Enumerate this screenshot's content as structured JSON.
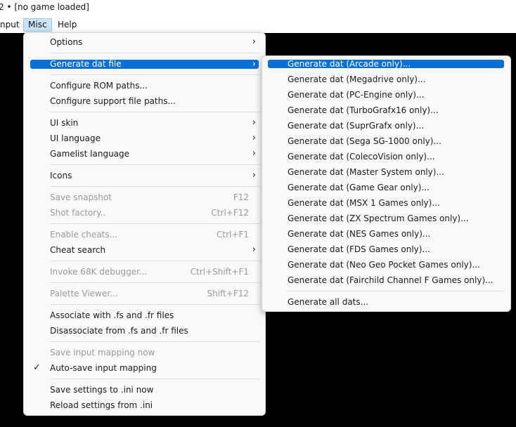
{
  "window": {
    "title": "2 • [no game loaded]"
  },
  "menubar": {
    "items": [
      "nput",
      "Misc",
      "Help"
    ]
  },
  "misc_menu": {
    "options": "Options",
    "generate_dat_file": "Generate dat file",
    "configure_rom_paths": "Configure ROM paths...",
    "configure_support_paths": "Configure support file paths...",
    "ui_skin": "UI skin",
    "ui_language": "UI language",
    "gamelist_language": "Gamelist language",
    "icons": "Icons",
    "save_snapshot": "Save snapshot",
    "save_snapshot_sc": "F12",
    "shot_factory": "Shot factory..",
    "shot_factory_sc": "Ctrl+F12",
    "enable_cheats": "Enable cheats...",
    "enable_cheats_sc": "Ctrl+F1",
    "cheat_search": "Cheat search",
    "invoke_debugger": "Invoke 68K debugger...",
    "invoke_debugger_sc": "Ctrl+Shift+F1",
    "palette_viewer": "Palette Viewer...",
    "palette_viewer_sc": "Shift+F12",
    "associate": "Associate with .fs and .fr files",
    "disassociate": "Disassociate from .fs and .fr files",
    "save_input_mapping": "Save input mapping now",
    "auto_save_input": "Auto-save input mapping",
    "save_settings": "Save settings to .ini now",
    "reload_settings": "Reload settings from .ini",
    "arrow_glyph": "›",
    "check_glyph": "✓"
  },
  "dat_submenu": {
    "items": [
      "Generate dat (Arcade only)...",
      "Generate dat (Megadrive only)...",
      "Generate dat (PC-Engine only)...",
      "Generate dat (TurboGrafx16 only)...",
      "Generate dat (SuprGrafx only)...",
      "Generate dat (Sega SG-1000 only)...",
      "Generate dat (ColecoVision only)...",
      "Generate dat (Master System only)...",
      "Generate dat (Game Gear only)...",
      "Generate dat (MSX 1 Games only)...",
      "Generate dat (ZX Spectrum Games only)...",
      "Generate dat (NES Games only)...",
      "Generate dat (FDS Games only)...",
      "Generate dat (Neo Geo Pocket Games only)...",
      "Generate dat (Fairchild Channel F Games only)..."
    ],
    "all": "Generate all dats..."
  },
  "colors": {
    "highlight": "#0a6fd6",
    "menu_bg": "#f9f9f9",
    "disabled": "#9a9a9a"
  }
}
